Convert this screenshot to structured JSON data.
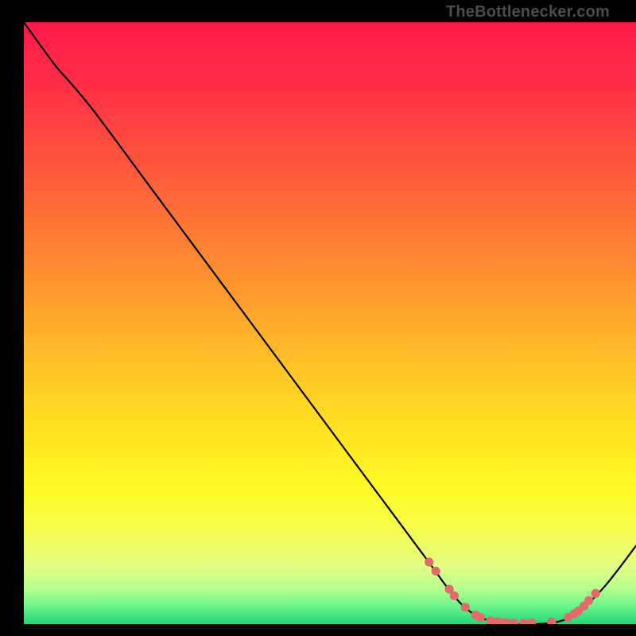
{
  "watermark": "TheBottlenecker.com",
  "chart_data": {
    "type": "line",
    "title": "",
    "xlabel": "",
    "ylabel": "",
    "xlim": [
      0,
      100
    ],
    "ylim": [
      0,
      100
    ],
    "background_gradient": {
      "stops": [
        {
          "offset": 0.0,
          "color": "#ff1a4b"
        },
        {
          "offset": 0.1,
          "color": "#ff2e46"
        },
        {
          "offset": 0.2,
          "color": "#ff4b3e"
        },
        {
          "offset": 0.3,
          "color": "#ff6a37"
        },
        {
          "offset": 0.4,
          "color": "#ff8a31"
        },
        {
          "offset": 0.5,
          "color": "#ffab2b"
        },
        {
          "offset": 0.6,
          "color": "#ffcc25"
        },
        {
          "offset": 0.7,
          "color": "#ffe820"
        },
        {
          "offset": 0.78,
          "color": "#fffb2a"
        },
        {
          "offset": 0.84,
          "color": "#f8ff4e"
        },
        {
          "offset": 0.9,
          "color": "#e6ff82"
        },
        {
          "offset": 0.94,
          "color": "#b8ff8f"
        },
        {
          "offset": 0.97,
          "color": "#6cf58a"
        },
        {
          "offset": 1.0,
          "color": "#22d675"
        }
      ]
    },
    "curve": [
      {
        "x": 0.0,
        "y": 100.0
      },
      {
        "x": 5.0,
        "y": 93.0
      },
      {
        "x": 8.0,
        "y": 89.5
      },
      {
        "x": 12.0,
        "y": 84.5
      },
      {
        "x": 20.0,
        "y": 73.5
      },
      {
        "x": 30.0,
        "y": 59.8
      },
      {
        "x": 40.0,
        "y": 46.1
      },
      {
        "x": 50.0,
        "y": 32.4
      },
      {
        "x": 60.0,
        "y": 18.7
      },
      {
        "x": 66.0,
        "y": 10.5
      },
      {
        "x": 70.0,
        "y": 5.0
      },
      {
        "x": 73.0,
        "y": 2.0
      },
      {
        "x": 76.0,
        "y": 0.6
      },
      {
        "x": 80.0,
        "y": 0.0
      },
      {
        "x": 84.0,
        "y": 0.0
      },
      {
        "x": 88.0,
        "y": 0.6
      },
      {
        "x": 91.0,
        "y": 2.4
      },
      {
        "x": 95.0,
        "y": 6.4
      },
      {
        "x": 100.0,
        "y": 13.0
      }
    ],
    "markers": [
      {
        "x": 66.2,
        "y": 10.3
      },
      {
        "x": 67.3,
        "y": 8.8
      },
      {
        "x": 69.5,
        "y": 5.8
      },
      {
        "x": 70.3,
        "y": 4.7
      },
      {
        "x": 72.1,
        "y": 2.8
      },
      {
        "x": 73.8,
        "y": 1.5
      },
      {
        "x": 74.6,
        "y": 1.1
      },
      {
        "x": 76.2,
        "y": 0.55
      },
      {
        "x": 77.3,
        "y": 0.35
      },
      {
        "x": 78.1,
        "y": 0.25
      },
      {
        "x": 78.9,
        "y": 0.2
      },
      {
        "x": 80.1,
        "y": 0.15
      },
      {
        "x": 81.7,
        "y": 0.15
      },
      {
        "x": 83.0,
        "y": 0.2
      },
      {
        "x": 86.2,
        "y": 0.35
      },
      {
        "x": 88.9,
        "y": 1.1
      },
      {
        "x": 89.9,
        "y": 1.7
      },
      {
        "x": 90.6,
        "y": 2.2
      },
      {
        "x": 91.5,
        "y": 3.0
      },
      {
        "x": 92.3,
        "y": 3.9
      },
      {
        "x": 93.4,
        "y": 5.1
      }
    ],
    "marker_color": "#e26a6a",
    "line_color": "#000000"
  }
}
